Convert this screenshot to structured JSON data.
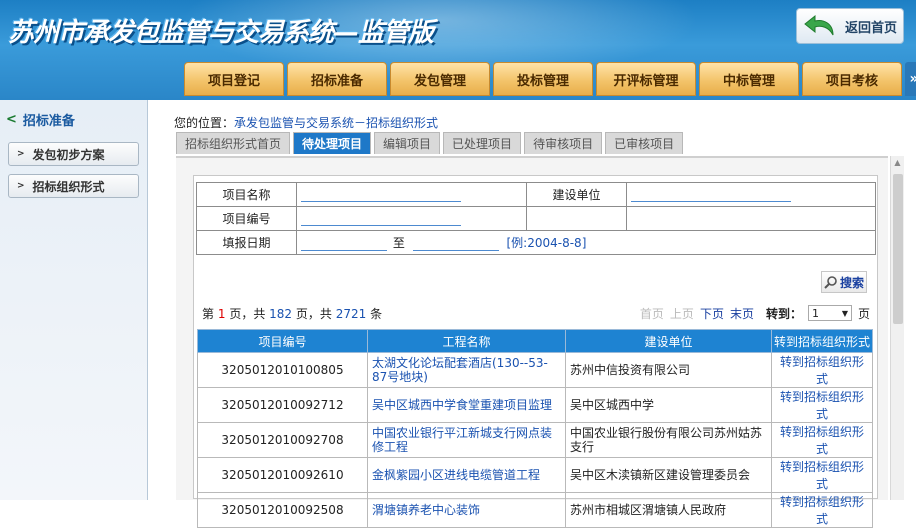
{
  "header": {
    "title": "苏州市承发包监管与交易系统—监管版",
    "return_label": "返回首页"
  },
  "nav": [
    "项目登记",
    "招标准备",
    "发包管理",
    "投标管理",
    "开评标管理",
    "中标管理",
    "项目考核"
  ],
  "nav_more": "»",
  "sidebar": {
    "title": "招标准备",
    "items": [
      {
        "label": "发包初步方案"
      },
      {
        "label": "招标组织形式"
      }
    ]
  },
  "location": {
    "prefix": "您的位置：",
    "path": "承发包监管与交易系统－招标组织形式"
  },
  "tabs": [
    "招标组织形式首页",
    "待处理项目",
    "编辑项目",
    "已处理项目",
    "待审核项目",
    "已审核项目"
  ],
  "search": {
    "project_name_label": "项目名称",
    "build_unit_label": "建设单位",
    "project_code_label": "项目编号",
    "date_label": "填报日期",
    "to_label": "至",
    "date_example": "[例:2004-8-8]",
    "search_label": "搜索"
  },
  "pager": {
    "page_prefix": "第",
    "current_page": "1",
    "page_mid": "页，共",
    "total_pages": "182",
    "page_mid2": "页，共",
    "total_items": "2721",
    "item_suffix": "条",
    "first": "首页",
    "prev": "上页",
    "next": "下页",
    "last": "末页",
    "goto_label": "转到：",
    "goto_value": "1",
    "goto_suffix": "页"
  },
  "table": {
    "headers": [
      "项目编号",
      "工程名称",
      "建设单位",
      "转到招标组织形式"
    ],
    "rows": [
      {
        "code": "3205012010100805",
        "name": "太湖文化论坛配套酒店(130--53-87号地块)",
        "unit": "苏州中信投资有限公司",
        "action": "转到招标组织形式"
      },
      {
        "code": "3205012010092712",
        "name": "吴中区城西中学食堂重建项目监理",
        "unit": "吴中区城西中学",
        "action": "转到招标组织形式"
      },
      {
        "code": "3205012010092708",
        "name": "中国农业银行平江新城支行网点装修工程",
        "unit": "中国农业银行股份有限公司苏州姑苏支行",
        "action": "转到招标组织形式"
      },
      {
        "code": "3205012010092610",
        "name": "金枫紫园小区进线电缆管道工程",
        "unit": "吴中区木渎镇新区建设管理委员会",
        "action": "转到招标组织形式"
      },
      {
        "code": "3205012010092508",
        "name": "渭塘镇养老中心装饰",
        "unit": "苏州市相城区渭塘镇人民政府",
        "action": "转到招标组织形式"
      }
    ]
  },
  "colors": {
    "header_blue": "#2a86c8",
    "nav_gold": "#f3c46b",
    "grid_header": "#1e83d2",
    "link_blue": "#1a52b0",
    "accent_red": "#d00"
  }
}
